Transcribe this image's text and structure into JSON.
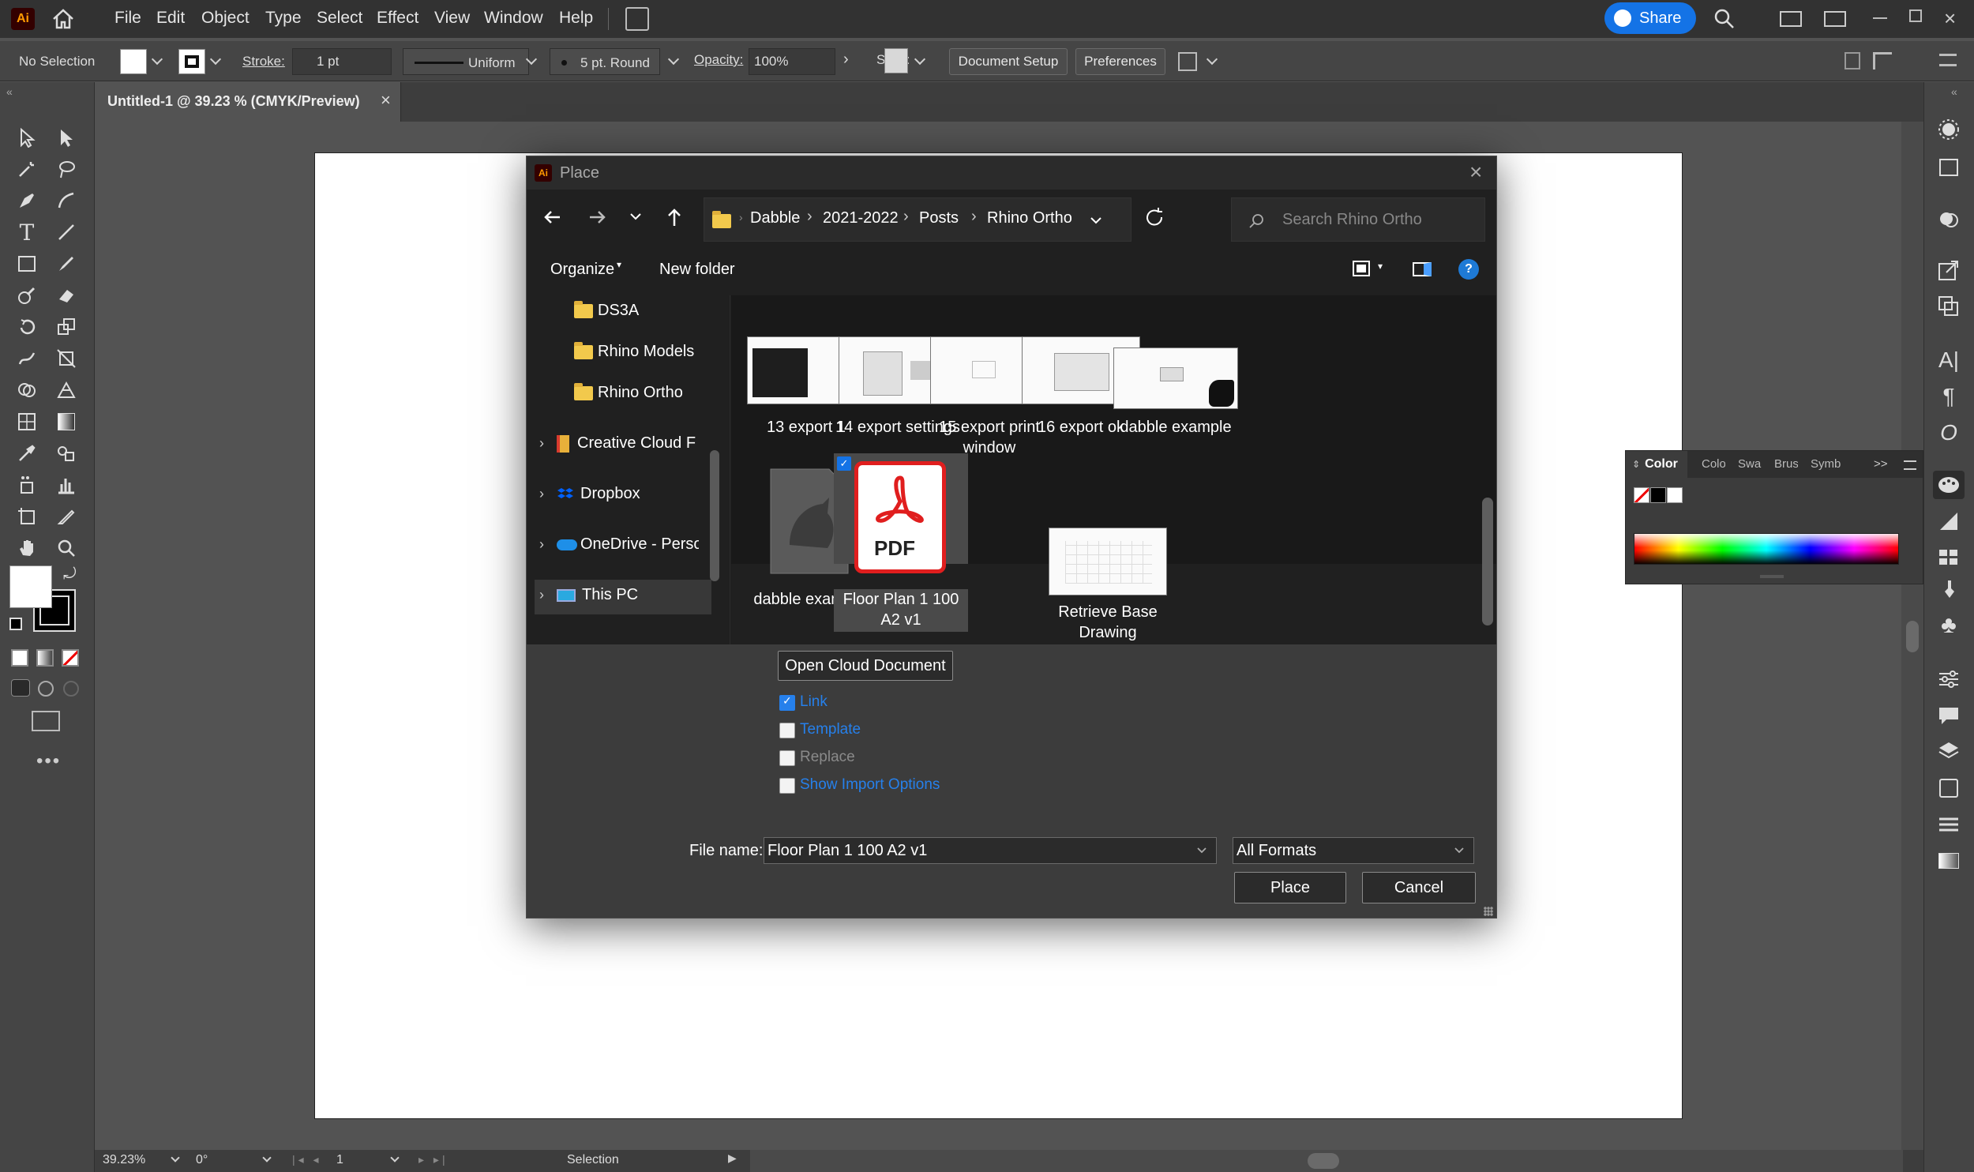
{
  "app": {
    "logo": "Ai",
    "share_label": "Share"
  },
  "menu": [
    "File",
    "Edit",
    "Object",
    "Type",
    "Select",
    "Effect",
    "View",
    "Window",
    "Help"
  ],
  "control": {
    "selection": "No Selection",
    "stroke_label": "Stroke:",
    "stroke_value": "1 pt",
    "profile": "Uniform",
    "brush": "5 pt. Round",
    "opacity_label": "Opacity:",
    "opacity_value": "100%",
    "style_label": "Style:",
    "doc_setup": "Document Setup",
    "preferences": "Preferences"
  },
  "doc_tab": {
    "title": "Untitled-1 @ 39.23 % (CMYK/Preview)",
    "close": "×"
  },
  "color_panel": {
    "tabs": [
      "Color",
      "Colo",
      "Swa",
      "Brus",
      "Symb"
    ],
    "active": "Color",
    "more": ">>"
  },
  "status": {
    "zoom": "39.23%",
    "rotate": "0°",
    "artboard": "1",
    "tool": "Selection"
  },
  "dialog": {
    "logo": "Ai",
    "title": "Place",
    "close": "×",
    "breadcrumb": [
      "Dabble",
      "2021-2022",
      "Posts",
      "Rhino Ortho"
    ],
    "search_placeholder": "Search Rhino Ortho",
    "organize": "Organize",
    "new_folder": "New folder",
    "help": "?",
    "nav": [
      {
        "label": "DS3A",
        "type": "folder"
      },
      {
        "label": "Rhino Models",
        "type": "folder"
      },
      {
        "label": "Rhino Ortho",
        "type": "folder"
      },
      {
        "label": "Creative Cloud Fi",
        "type": "cc"
      },
      {
        "label": "Dropbox",
        "type": "dropbox"
      },
      {
        "label": "OneDrive - Perso",
        "type": "onedrive"
      },
      {
        "label": "This PC",
        "type": "pc"
      }
    ],
    "files": [
      {
        "name": "13 export 1"
      },
      {
        "name": "14 export settings"
      },
      {
        "name": "15 export print window"
      },
      {
        "name": "16 export ok"
      },
      {
        "name": "dabble example"
      },
      {
        "name": "dabble example"
      },
      {
        "name": "Floor Plan 1 100 A2 v1",
        "selected": true,
        "badge": "PDF"
      },
      {
        "name": "Retrieve Base Drawing"
      }
    ],
    "open_cloud": "Open Cloud Document",
    "options": [
      {
        "label": "Link",
        "checked": true
      },
      {
        "label": "Template",
        "checked": false
      },
      {
        "label": "Replace",
        "checked": false
      },
      {
        "label": "Show Import Options",
        "checked": false
      }
    ],
    "filename_label": "File name:",
    "filename_value": "Floor Plan 1 100 A2 v1",
    "format": "All Formats",
    "place": "Place",
    "cancel": "Cancel"
  }
}
